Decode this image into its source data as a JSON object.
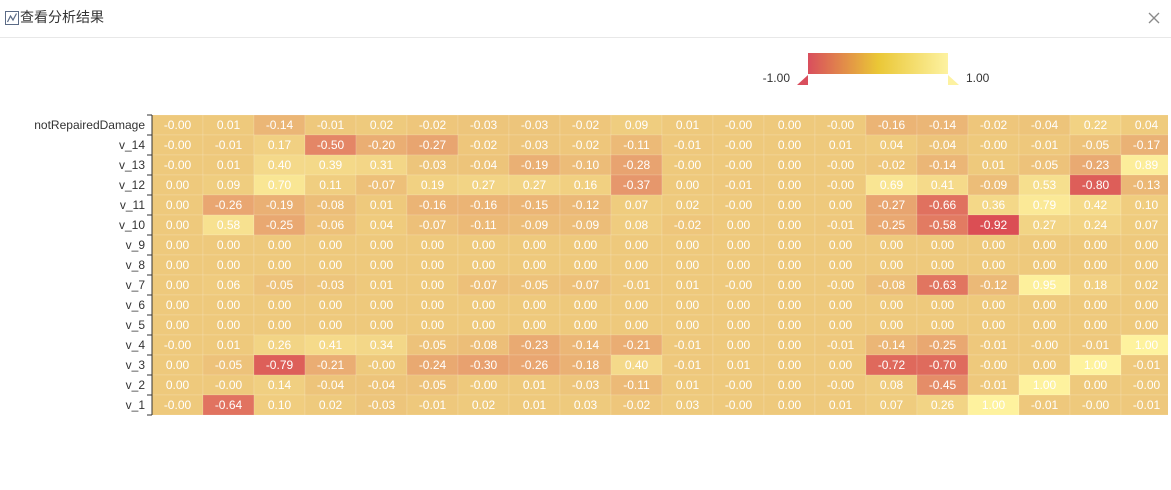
{
  "window": {
    "title": "查看分析结果",
    "close_label": "×"
  },
  "icons": {
    "title": "chart-icon",
    "close": "close-icon"
  },
  "chart_data": {
    "type": "heatmap",
    "rows": [
      "notRepairedDamage",
      "v_14",
      "v_13",
      "v_12",
      "v_11",
      "v_10",
      "v_9",
      "v_8",
      "v_7",
      "v_6",
      "v_5",
      "v_4",
      "v_3",
      "v_2",
      "v_1"
    ],
    "values": [
      [
        "-0.00",
        "0.01",
        "-0.14",
        "-0.01",
        "0.02",
        "-0.02",
        "-0.03",
        "-0.03",
        "-0.02",
        "0.09",
        "0.01",
        "-0.00",
        "0.00",
        "-0.00",
        "-0.16",
        "-0.14",
        "-0.02",
        "-0.04",
        "0.22",
        "0.04"
      ],
      [
        "-0.00",
        "-0.01",
        "0.17",
        "-0.50",
        "-0.20",
        "-0.27",
        "-0.02",
        "-0.03",
        "-0.02",
        "-0.11",
        "-0.01",
        "-0.00",
        "0.00",
        "0.01",
        "0.04",
        "-0.04",
        "-0.00",
        "-0.01",
        "-0.05",
        "-0.17"
      ],
      [
        "-0.00",
        "0.01",
        "0.40",
        "0.39",
        "0.31",
        "-0.03",
        "-0.04",
        "-0.19",
        "-0.10",
        "-0.28",
        "-0.00",
        "-0.00",
        "0.00",
        "-0.00",
        "-0.02",
        "-0.14",
        "0.01",
        "-0.05",
        "-0.23",
        "0.89"
      ],
      [
        "0.00",
        "0.09",
        "0.70",
        "0.11",
        "-0.07",
        "0.19",
        "0.27",
        "0.27",
        "0.16",
        "-0.37",
        "0.00",
        "-0.01",
        "0.00",
        "-0.00",
        "0.69",
        "0.41",
        "-0.09",
        "0.53",
        "-0.80",
        "-0.13"
      ],
      [
        "0.00",
        "-0.26",
        "-0.19",
        "-0.08",
        "0.01",
        "-0.16",
        "-0.16",
        "-0.15",
        "-0.12",
        "0.07",
        "0.02",
        "-0.00",
        "0.00",
        "0.00",
        "-0.27",
        "-0.66",
        "0.36",
        "0.79",
        "0.42",
        "0.10"
      ],
      [
        "0.00",
        "0.58",
        "-0.25",
        "-0.06",
        "0.04",
        "-0.07",
        "-0.11",
        "-0.09",
        "-0.09",
        "0.08",
        "-0.02",
        "0.00",
        "0.00",
        "-0.01",
        "-0.25",
        "-0.58",
        "-0.92",
        "0.27",
        "0.24",
        "0.07"
      ],
      [
        "0.00",
        "0.00",
        "0.00",
        "0.00",
        "0.00",
        "0.00",
        "0.00",
        "0.00",
        "0.00",
        "0.00",
        "0.00",
        "0.00",
        "0.00",
        "0.00",
        "0.00",
        "0.00",
        "0.00",
        "0.00",
        "0.00",
        "0.00"
      ],
      [
        "0.00",
        "0.00",
        "0.00",
        "0.00",
        "0.00",
        "0.00",
        "0.00",
        "0.00",
        "0.00",
        "0.00",
        "0.00",
        "0.00",
        "0.00",
        "0.00",
        "0.00",
        "0.00",
        "0.00",
        "0.00",
        "0.00",
        "0.00"
      ],
      [
        "0.00",
        "0.06",
        "-0.05",
        "-0.03",
        "0.01",
        "0.00",
        "-0.07",
        "-0.05",
        "-0.07",
        "-0.01",
        "0.01",
        "-0.00",
        "0.00",
        "-0.00",
        "-0.08",
        "-0.63",
        "-0.12",
        "0.95",
        "0.18",
        "0.02"
      ],
      [
        "0.00",
        "0.00",
        "0.00",
        "0.00",
        "0.00",
        "0.00",
        "0.00",
        "0.00",
        "0.00",
        "0.00",
        "0.00",
        "0.00",
        "0.00",
        "0.00",
        "0.00",
        "0.00",
        "0.00",
        "0.00",
        "0.00",
        "0.00"
      ],
      [
        "0.00",
        "0.00",
        "0.00",
        "0.00",
        "0.00",
        "0.00",
        "0.00",
        "0.00",
        "0.00",
        "0.00",
        "0.00",
        "0.00",
        "0.00",
        "0.00",
        "0.00",
        "0.00",
        "0.00",
        "0.00",
        "0.00",
        "0.00"
      ],
      [
        "-0.00",
        "0.01",
        "0.26",
        "0.41",
        "0.34",
        "-0.05",
        "-0.08",
        "-0.23",
        "-0.14",
        "-0.21",
        "-0.01",
        "0.00",
        "0.00",
        "-0.01",
        "-0.14",
        "-0.25",
        "-0.01",
        "-0.00",
        "-0.01",
        "1.00"
      ],
      [
        "0.00",
        "-0.05",
        "-0.79",
        "-0.21",
        "-0.00",
        "-0.24",
        "-0.30",
        "-0.26",
        "-0.18",
        "0.40",
        "-0.01",
        "0.01",
        "0.00",
        "0.00",
        "-0.72",
        "-0.70",
        "-0.00",
        "0.00",
        "1.00",
        "-0.01"
      ],
      [
        "0.00",
        "-0.00",
        "0.14",
        "-0.04",
        "-0.04",
        "-0.05",
        "-0.00",
        "0.01",
        "-0.03",
        "-0.11",
        "0.01",
        "-0.00",
        "0.00",
        "-0.00",
        "0.08",
        "-0.45",
        "-0.01",
        "1.00",
        "0.00",
        "-0.00"
      ],
      [
        "-0.00",
        "-0.64",
        "0.10",
        "0.02",
        "-0.03",
        "-0.01",
        "0.02",
        "0.01",
        "0.03",
        "-0.02",
        "0.03",
        "-0.00",
        "0.00",
        "0.01",
        "0.07",
        "0.26",
        "1.00",
        "-0.01",
        "-0.00",
        "-0.01"
      ]
    ],
    "visual_map": {
      "min": -1,
      "max": 1,
      "min_label": "-1.00",
      "max_label": "1.00",
      "colors": [
        "#d94e5d",
        "#eac736",
        "#fdf2a1"
      ]
    },
    "cell_colors": {
      "strong_negative": "#d94350",
      "neutral": "#eec97c",
      "strong_positive": "#fef29e"
    }
  }
}
